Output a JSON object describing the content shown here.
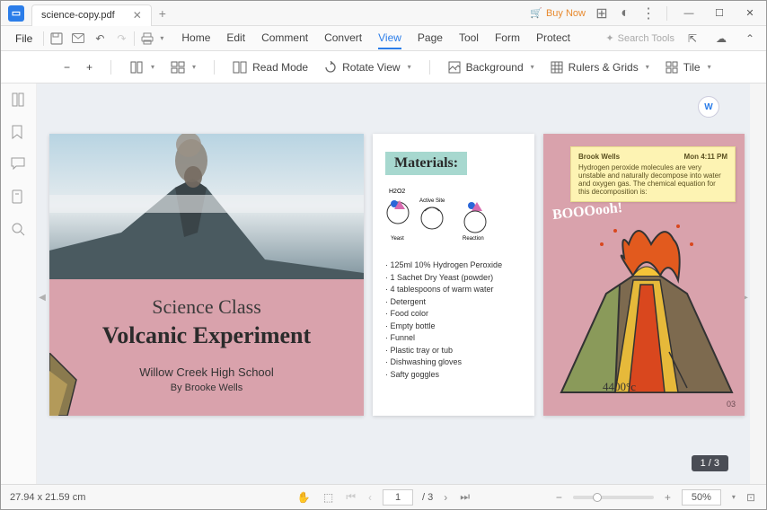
{
  "app": {
    "tab_title": "science-copy.pdf",
    "buy_now": "Buy Now"
  },
  "menu": {
    "file": "File",
    "tabs": [
      "Home",
      "Edit",
      "Comment",
      "Convert",
      "View",
      "Page",
      "Tool",
      "Form",
      "Protect"
    ],
    "active_tab": "View",
    "search_placeholder": "Search Tools"
  },
  "toolbar": {
    "read_mode": "Read Mode",
    "rotate_view": "Rotate View",
    "background": "Background",
    "rulers_grids": "Rulers & Grids",
    "tile": "Tile"
  },
  "doc": {
    "page_indicator": "1 / 3",
    "word_badge": "W",
    "p1": {
      "subtitle": "Science Class",
      "title": "Volcanic Experiment",
      "school": "Willow Creek High School",
      "byline": "By Brooke Wells"
    },
    "p2": {
      "heading": "Materials:",
      "diagram_labels": {
        "formula": "H2O2",
        "active": "Active Site",
        "yeast": "Yeast",
        "reaction": "Reaction"
      },
      "items": [
        "125ml 10% Hydrogen Peroxide",
        "1 Sachet Dry Yeast (powder)",
        "4 tablespoons of warm water",
        "Detergent",
        "Food color",
        "Empty bottle",
        "Funnel",
        "Plastic tray or tub",
        "Dishwashing gloves",
        "Safty goggles"
      ]
    },
    "p3": {
      "note": {
        "author": "Brook Wells",
        "time": "Mon 4:11 PM",
        "body": "Hydrogen peroxide molecules are very unstable and naturally decompose into water and oxygen gas. The chemical equation for this decomposition is:"
      },
      "boom": "BOOOooh!",
      "temp": "4400°c",
      "page_num": "03"
    }
  },
  "status": {
    "dims": "27.94 x 21.59 cm",
    "page_current": "1",
    "page_total": "/ 3",
    "zoom": "50%"
  }
}
